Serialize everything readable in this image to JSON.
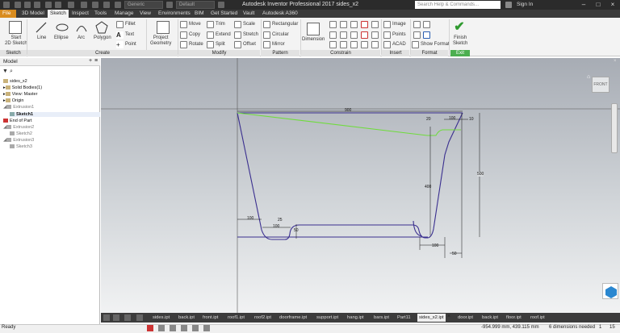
{
  "title_bar": {
    "app_title": "Autodesk Inventor Professional 2017   sides_x2",
    "material": "Generic",
    "appearance": "Default",
    "search_placeholder": "Search Help & Commands...",
    "signin": "Sign In"
  },
  "tabs": [
    "File",
    "3D Model",
    "Sketch",
    "Inspect",
    "Tools",
    "Manage",
    "View",
    "Environments",
    "BIM",
    "Get Started",
    "Vault",
    "Autodesk A360"
  ],
  "ribbon": {
    "start_sketch": "Start\n2D Sketch",
    "sketch_group": "Sketch",
    "line": "Line",
    "ellipse": "Ellipse",
    "arc": "Arc",
    "polygon": "Polygon",
    "fillet": "Fillet",
    "text": "Text",
    "point": "Point",
    "create_group": "Create",
    "project_geometry": "Project\nGeometry",
    "move": "Move",
    "copy": "Copy",
    "rotate": "Rotate",
    "trim": "Trim",
    "extend": "Extend",
    "split": "Split",
    "scale": "Scale",
    "stretch": "Stretch",
    "offset": "Offset",
    "modify_group": "Modify",
    "rectangular": "Rectangular",
    "circular": "Circular",
    "mirror": "Mirror",
    "pattern_group": "Pattern",
    "dimension": "Dimension",
    "constrain_group": "Constrain",
    "image": "Image",
    "points": "Points",
    "acad": "ACAD",
    "insert_group": "Insert",
    "show_format": "Show Format",
    "format_group": "Format",
    "finish_sketch": "Finish\nSketch",
    "exit_group": "Exit"
  },
  "browser": {
    "title": "Model",
    "items": [
      {
        "label": "sides_x2",
        "dim": false
      },
      {
        "label": "Solid Bodies(1)",
        "dim": false
      },
      {
        "label": "View: Master",
        "dim": false
      },
      {
        "label": "Origin",
        "dim": false
      },
      {
        "label": "Extrusion1",
        "dim": true
      },
      {
        "label": "Sketch1",
        "dim": false
      },
      {
        "label": "End of Part",
        "dim": false
      },
      {
        "label": "Extrusion2",
        "dim": true
      },
      {
        "label": "Sketch2",
        "dim": true
      },
      {
        "label": "Extrusion3",
        "dim": true
      },
      {
        "label": "Sketch3",
        "dim": true
      }
    ]
  },
  "canvas": {
    "viewcube": "FRONT",
    "dimensions": [
      "900",
      "20",
      "100",
      "10",
      "400",
      "500",
      "100",
      "25",
      "100",
      "50",
      "100",
      "50"
    ]
  },
  "doc_tabs": [
    "sides.ipt",
    "back.ipt",
    "front.ipt",
    "roof1.ipt",
    "roof2.ipt",
    "doorframe.ipt",
    "support.ipt",
    "hang.ipt",
    "bars.ipt",
    "Part11",
    "sides_x2.ipt",
    "door.ipt",
    "back.ipt",
    "floor.ipt",
    "roof.ipt"
  ],
  "status": {
    "ready": "Ready",
    "coords": "-954.999 mm, 439.115 mm",
    "dims_needed": "6 dimensions needed",
    "count1": "1",
    "count2": "15"
  },
  "colors": {
    "file_tab": "#d98c1f",
    "sketch_line": "#3a2f8f",
    "highlight_line": "#6fdc3c",
    "finish_green": "#2f9a2f"
  }
}
